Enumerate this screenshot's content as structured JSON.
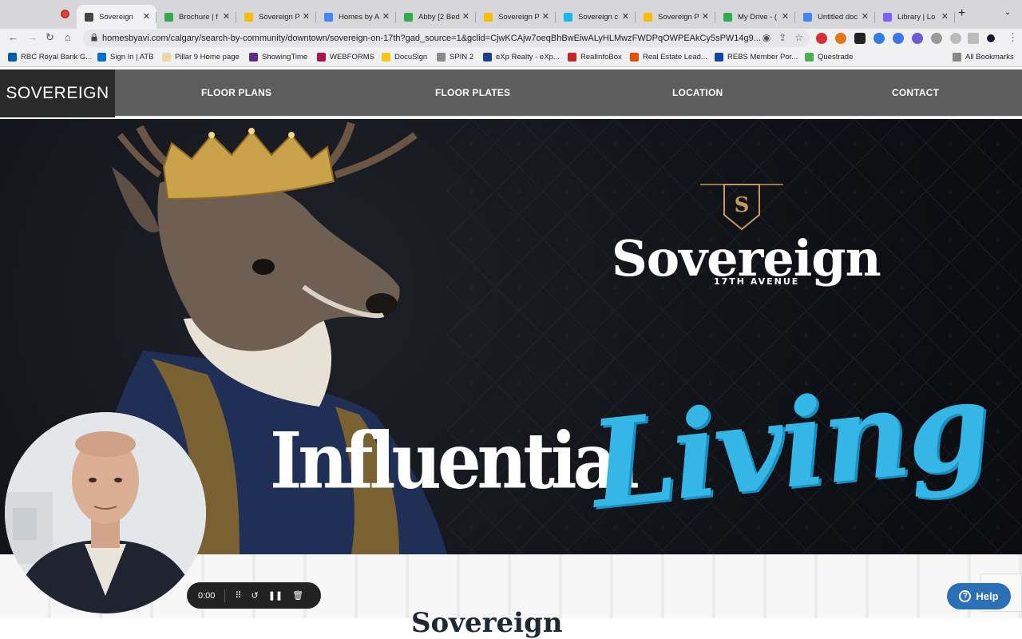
{
  "browser": {
    "tabs": [
      {
        "title": "Sovereign",
        "color": "#444444",
        "active": true
      },
      {
        "title": "Brochure | f",
        "color": "#34a853",
        "active": false
      },
      {
        "title": "Sovereign P",
        "color": "#fbbc04",
        "active": false
      },
      {
        "title": "Homes by A",
        "color": "#4285f4",
        "active": false
      },
      {
        "title": "Abby [2 Bed",
        "color": "#34a853",
        "active": false
      },
      {
        "title": "Sovereign P",
        "color": "#fbbc04",
        "active": false
      },
      {
        "title": "Sovereign c",
        "color": "#1ab7ea",
        "active": false
      },
      {
        "title": "Sovereign P",
        "color": "#fbbc04",
        "active": false
      },
      {
        "title": "My Drive - (",
        "color": "#34a853",
        "active": false
      },
      {
        "title": "Untitled doc",
        "color": "#4285f4",
        "active": false
      },
      {
        "title": "Library | Lo",
        "color": "#7b61ff",
        "active": false
      }
    ],
    "url": "homesbyavi.com/calgary/search-by-community/downtown/sovereign-on-17th?gad_source=1&gclid=CjwKCAjw7oeqBhBwEiwALyHLMwzFWDPqOWPEAkCy5sPW14g9...",
    "bookmarks": [
      {
        "label": "RBC Royal Bank G...",
        "color": "#005daa"
      },
      {
        "label": "Sign In | ATB",
        "color": "#0072ce"
      },
      {
        "label": "Pillar 9 Home page",
        "color": "#e8d9a8"
      },
      {
        "label": "ShowingTime",
        "color": "#5b2a86"
      },
      {
        "label": "WEBFORMS",
        "color": "#b0124f"
      },
      {
        "label": "DocuSign",
        "color": "#f5c518"
      },
      {
        "label": "SPIN 2",
        "color": "#888888"
      },
      {
        "label": "eXp Realty - eXp...",
        "color": "#1c3f94"
      },
      {
        "label": "RealInfoBox",
        "color": "#c62828"
      },
      {
        "label": "Real Estate Lead...",
        "color": "#e65100"
      },
      {
        "label": "REBS Member Por...",
        "color": "#0d47a1"
      },
      {
        "label": "Questrade",
        "color": "#4caf50"
      }
    ],
    "all_bookmarks": "All Bookmarks"
  },
  "site": {
    "logo": "SOVEREIGN",
    "nav": [
      "FLOOR PLANS",
      "FLOOR PLATES",
      "LOCATION",
      "CONTACT"
    ]
  },
  "hero": {
    "crest_letter": "S",
    "brand": "Sovereign",
    "brand_sub": "17TH AVENUE",
    "tagline_1": "Influential",
    "tagline_2": "Living",
    "accent_color": "#34b7e6"
  },
  "section_title": "Sovereign",
  "help": {
    "label": "Help"
  },
  "recorder": {
    "time": "0:00"
  }
}
